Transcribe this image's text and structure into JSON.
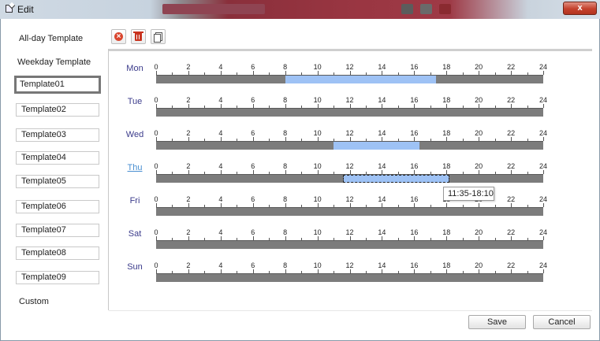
{
  "window": {
    "title": "Edit",
    "close_label": "x"
  },
  "sidebar": {
    "allday_label": "All-day Template",
    "weekday_label": "Weekday Template",
    "templates": [
      "Template01",
      "Template02",
      "Template03",
      "Template04",
      "Template05",
      "Template06",
      "Template07",
      "Template08",
      "Template09"
    ],
    "selected_template": "Template01",
    "custom_label": "Custom"
  },
  "toolbar": {
    "icons": [
      "delete-icon",
      "trash-icon",
      "copy-icon"
    ]
  },
  "schedule": {
    "tick_labels": [
      "0",
      "2",
      "4",
      "6",
      "8",
      "10",
      "12",
      "14",
      "16",
      "18",
      "20",
      "22",
      "24"
    ],
    "days": [
      {
        "label": "Mon",
        "segments": [
          {
            "start": "08:00",
            "end": "17:20"
          }
        ]
      },
      {
        "label": "Tue",
        "segments": []
      },
      {
        "label": "Wed",
        "segments": [
          {
            "start": "11:00",
            "end": "16:20"
          }
        ]
      },
      {
        "label": "Thu",
        "active": true,
        "segments": [
          {
            "start": "11:35",
            "end": "18:10",
            "selected": true
          }
        ]
      },
      {
        "label": "Fri",
        "segments": []
      },
      {
        "label": "Sat",
        "segments": []
      },
      {
        "label": "Sun",
        "segments": []
      }
    ],
    "tooltip": "11:35-18:10"
  },
  "buttons": {
    "save": "Save",
    "cancel": "Cancel"
  },
  "colors": {
    "segment": "#9ec2f5",
    "bar": "#7c7c7c",
    "day_label": "#3b3b8b",
    "active_day": "#4a8fd1"
  }
}
